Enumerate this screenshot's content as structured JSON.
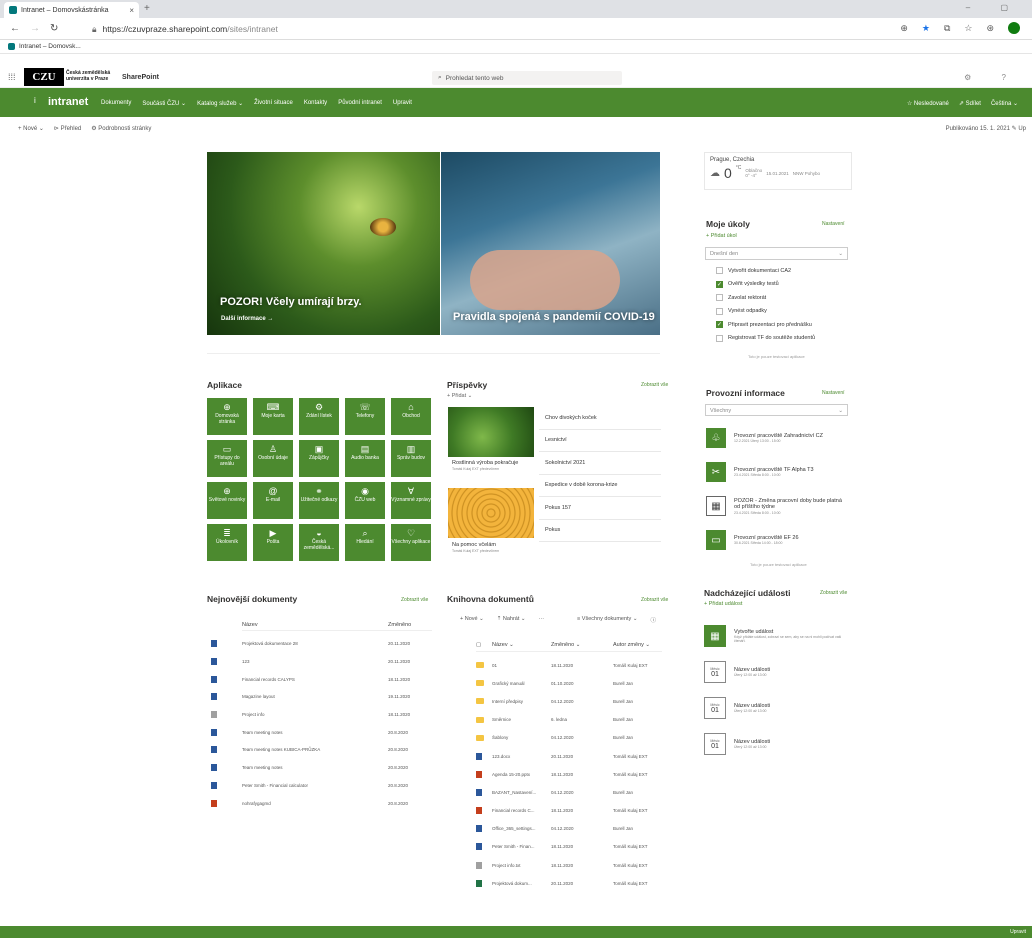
{
  "browser": {
    "tab_title": "Intranet – Domovskástránka",
    "tab_close": "×",
    "new_tab": "+",
    "window_controls": "–   ▢",
    "back": "←",
    "forward": "→",
    "reload": "↻",
    "url_main": "https://czuvpraze.sharepoint.com",
    "url_path": "/sites/intranet",
    "favorites_item": "Intranet – Domovsk...",
    "icons": [
      "zoom-icon",
      "star-icon",
      "collections-icon",
      "favorites-icon",
      "share-icon",
      "profile-icon"
    ]
  },
  "suite": {
    "waffle": "⁞⁞⁞",
    "logo": "CZU",
    "logo_line1": "Česká zemědělská",
    "logo_line2": "univerzita v Praze",
    "app_name": "SharePoint",
    "search_placeholder": "Prohledat tento web",
    "right_icons": "⚙ ?"
  },
  "hub": {
    "icon": "i",
    "title": "intranet",
    "nav": [
      "Dokumenty",
      "Součásti ČZU ⌄",
      "Katalog služeb ⌄",
      "Životní situace",
      "Kontakty",
      "Původní intranet",
      "Upravit"
    ],
    "right": [
      "☆ Nesledované",
      "⇗ Sdílet",
      "Čeština ⌄"
    ],
    "color": "#4c8a2f"
  },
  "commandbar": {
    "items": [
      "+ Nové ⌄",
      "⊳ Přehled",
      "⚙ Podrobnosti stránky"
    ],
    "published": "Publikováno 15. 1. 2021   ✎ Up"
  },
  "hero": {
    "left_title": "POZOR! Včely umírají brzy.",
    "left_link": "Další informace →",
    "right_title": "Pravidla spojená s pandemií COVID-19"
  },
  "weather": {
    "city": "Prague, Czechia",
    "temp": "0",
    "unit": "°C",
    "condition": "Oblačno",
    "range": "0° -4°",
    "date": "15.01.2021",
    "wind": "NNW Pohybo"
  },
  "tasks": {
    "title": "Moje úkoly",
    "manage": "Nastavení",
    "add": "+ Přidat úkol",
    "filter": "Dnešní den",
    "items": [
      {
        "label": "Vytvořit dokumentaci CA2",
        "done": false
      },
      {
        "label": "Ověřit výsledky testů",
        "done": true
      },
      {
        "label": "Zavolat rektorát",
        "done": false
      },
      {
        "label": "Vynést odpadky",
        "done": false
      },
      {
        "label": "Připravit prezentaci pro přednášku",
        "done": true
      },
      {
        "label": "Registrovat TF do soutěže studentů",
        "done": false
      }
    ],
    "footer": "Toto je pouze testovací aplikace"
  },
  "apps": {
    "title": "Aplikace",
    "items": [
      {
        "icon": "⊕",
        "label": "Domovská stránka"
      },
      {
        "icon": "⌨",
        "label": "Moje karta"
      },
      {
        "icon": "⚙",
        "label": "Zdání lístek"
      },
      {
        "icon": "☏",
        "label": "Telefony"
      },
      {
        "icon": "⌂",
        "label": "Obchod"
      },
      {
        "icon": "▭",
        "label": "Přístupy do areálu"
      },
      {
        "icon": "♙",
        "label": "Osobní údaje"
      },
      {
        "icon": "▣",
        "label": "Zápůjčky"
      },
      {
        "icon": "▤",
        "label": "Audio banka"
      },
      {
        "icon": "▥",
        "label": "Správ budov"
      },
      {
        "icon": "⊕",
        "label": "Světové novinky"
      },
      {
        "icon": "@",
        "label": "E-mail"
      },
      {
        "icon": "⚭",
        "label": "Užitečné odkazy"
      },
      {
        "icon": "◉",
        "label": "ČZU web"
      },
      {
        "icon": "∀",
        "label": "Významné zprávy"
      },
      {
        "icon": "≣",
        "label": "Úkolovník"
      },
      {
        "icon": "▶",
        "label": "Pošta"
      },
      {
        "icon": "◒",
        "label": "Česká zemědělská..."
      },
      {
        "icon": "⌕",
        "label": "Hledání"
      },
      {
        "icon": "♡",
        "label": "Všechny aplikace"
      }
    ]
  },
  "posts": {
    "title": "Příspěvky",
    "see_all": "Zobrazit vše",
    "add": "+ Přidat ⌄",
    "featured": [
      {
        "caption": "Rostlinná výroba pokračuje",
        "meta": "Tomáš Kulaj EXT  předevčírem"
      },
      {
        "caption": "Na pomoc včelám",
        "meta": "Tomáš Kulaj EXT  předevčírem"
      }
    ],
    "list": [
      "Chov divokých koček",
      "Lesnictví",
      "Sokolnictví 2021",
      "Expedice v době korona-krize",
      "Pokus 157",
      "Pokus"
    ]
  },
  "provozni": {
    "title": "Provozní informace",
    "manage": "Nastavení",
    "filter": "Všechny",
    "items": [
      {
        "icon": "♧",
        "white": false,
        "title": "Provozní pracoviště Zahradnictví CZ",
        "meta": "12.2.2021  Úterý 13:00 - 15:00"
      },
      {
        "icon": "✂",
        "white": false,
        "title": "Provozní pracoviště TF Alpha T3",
        "meta": "23.4.2021  Středa 8:00 - 10:00"
      },
      {
        "icon": "▦",
        "white": true,
        "title": "POZOR - Změna pracovní doby bude platná od příštího týdne",
        "meta": "23.4.2021  Středa 8:00 - 10:00"
      },
      {
        "icon": "▭",
        "white": false,
        "title": "Provozní pracoviště EF 26",
        "meta": "30.6.2021  Středa 14:00 - 18:00"
      }
    ],
    "footer": "Toto je pouze testovací aplikace"
  },
  "recent": {
    "title": "Nejnovější dokumenty",
    "see_all": "Zobrazit vše",
    "col_name": "Název",
    "col_changed": "Změněno",
    "rows": [
      {
        "name": "Projektová dokumentace 28",
        "date": "20.11.2020",
        "color": "#2b579a"
      },
      {
        "name": "123",
        "date": "20.11.2020",
        "color": "#2b579a"
      },
      {
        "name": "Financial records CALYPS",
        "date": "18.11.2020",
        "color": "#2b579a"
      },
      {
        "name": "Magazine layout",
        "date": "19.11.2020",
        "color": "#2b579a"
      },
      {
        "name": "Project info",
        "date": "18.11.2020",
        "color": "#a0a0a0"
      },
      {
        "name": "Team meeting notes",
        "date": "20.8.2020",
        "color": "#2b579a"
      },
      {
        "name": "Team meeting notes KUBICA-PRŮZKA",
        "date": "20.8.2020",
        "color": "#2b579a"
      },
      {
        "name": "Team meeting notes",
        "date": "20.8.2020",
        "color": "#2b579a"
      },
      {
        "name": "Peter Smith - Financial calculator",
        "date": "20.8.2020",
        "color": "#2b579a"
      },
      {
        "name": "nohrafygagmd",
        "date": "20.8.2020",
        "color": "#c43e1c"
      }
    ]
  },
  "library": {
    "title": "Knihovna dokumentů",
    "see_all": "Zobrazit vše",
    "cmd_new": "+ Nové ⌄",
    "cmd_upload": "⇡ Nahrát ⌄",
    "cmd_more": "···",
    "cmd_view": "≡ Všechny dokumenty ⌄",
    "cmd_info": "ⓘ",
    "col_name": "Název ⌄",
    "col_changed": "Změněno ⌄",
    "col_author": "Autor změny ⌄",
    "rows": [
      {
        "kind": "folder",
        "name": "01",
        "date": "18.11.2020",
        "author": "Tomáš Kulaj EXT"
      },
      {
        "kind": "folder",
        "name": "Grafický manuál",
        "date": "01.10.2020",
        "author": "Burell Jan"
      },
      {
        "kind": "folder",
        "name": "Interní předpisy",
        "date": "04.12.2020",
        "author": "Burell Jan"
      },
      {
        "kind": "folder",
        "name": "Směrnice",
        "date": "6. ledna",
        "author": "Burell Jan"
      },
      {
        "kind": "folder",
        "name": "Šablony",
        "date": "04.12.2020",
        "author": "Burell Jan"
      },
      {
        "kind": "doc",
        "name": "123.docx",
        "date": "20.11.2020",
        "author": "Tomáš Kulaj EXT",
        "color": "#2b579a"
      },
      {
        "kind": "doc",
        "name": "Agenda 15-20.pptx",
        "date": "18.11.2020",
        "author": "Tomáš Kulaj EXT",
        "color": "#c43e1c"
      },
      {
        "kind": "doc",
        "name": "BAZANT_Nastavení...",
        "date": "04.12.2020",
        "author": "Burell Jan",
        "color": "#2b579a"
      },
      {
        "kind": "doc",
        "name": "Financial records C...",
        "date": "18.11.2020",
        "author": "Tomáš Kulaj EXT",
        "color": "#c43e1c"
      },
      {
        "kind": "doc",
        "name": "Office_365_settings...",
        "date": "04.12.2020",
        "author": "Burell Jan",
        "color": "#2b579a"
      },
      {
        "kind": "doc",
        "name": "Peter Smith - Finan...",
        "date": "18.11.2020",
        "author": "Tomáš Kulaj EXT",
        "color": "#2b579a"
      },
      {
        "kind": "doc",
        "name": "Project info.txt",
        "date": "18.11.2020",
        "author": "Tomáš Kulaj EXT",
        "color": "#a0a0a0"
      },
      {
        "kind": "doc",
        "name": "Projektová dokum...",
        "date": "20.11.2020",
        "author": "Tomáš Kulaj EXT",
        "color": "#217346"
      }
    ]
  },
  "events": {
    "title": "Nadcházející události",
    "see_all": "Zobrazit vše",
    "add": "+ Přidat událost",
    "promo_title": "Vytvořte událost",
    "promo_text": "Když přidáte událost, zobrazí se sem, aby se na ni mohli podívat vaši čtenáři.",
    "items": [
      {
        "month": "Měsíc",
        "day": "01",
        "title": "Název události",
        "meta": "Úterý 12:00 až 13:00"
      },
      {
        "month": "Měsíc",
        "day": "01",
        "title": "Název události",
        "meta": "Úterý 12:00 až 13:00"
      },
      {
        "month": "Měsíc",
        "day": "01",
        "title": "Název události",
        "meta": "Úterý 12:00 až 13:00"
      }
    ]
  },
  "footer": {
    "text": "Upravit"
  }
}
